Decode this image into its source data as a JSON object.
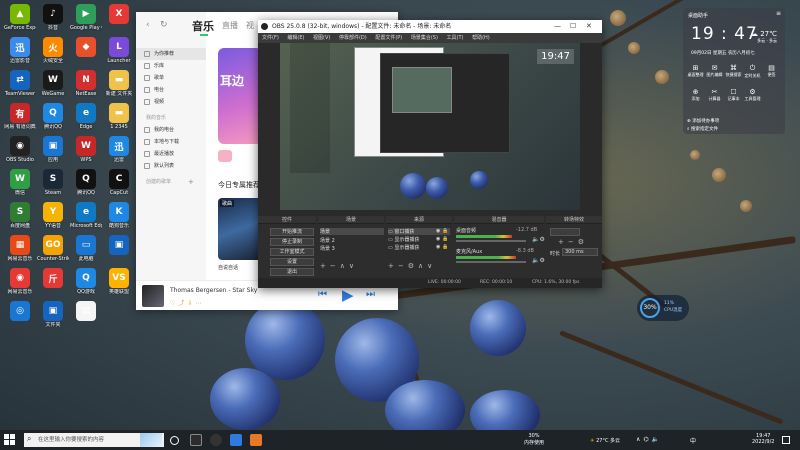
{
  "desktop": {
    "icons": [
      {
        "label": "GeForce Experience",
        "color": "#76b900",
        "glyph": "▲"
      },
      {
        "label": "抖音",
        "color": "#111111",
        "glyph": "♪"
      },
      {
        "label": "Google Play Games",
        "color": "#2f9e5b",
        "glyph": "▶"
      },
      {
        "label": "",
        "color": "#e53935",
        "glyph": "X"
      },
      {
        "label": "迅雷影音",
        "color": "#3b8be8",
        "glyph": "迅"
      },
      {
        "label": "火绒安全",
        "color": "#ff8a00",
        "glyph": "火"
      },
      {
        "label": "",
        "color": "#e94f2b",
        "glyph": "◆"
      },
      {
        "label": "Launcher",
        "color": "#7b4ad8",
        "glyph": "L"
      },
      {
        "label": "TeamViewer",
        "color": "#1565c0",
        "glyph": "⇄"
      },
      {
        "label": "WeGame",
        "color": "#1a1a1a",
        "glyph": "W"
      },
      {
        "label": "NetEase",
        "color": "#d32f2f",
        "glyph": "N"
      },
      {
        "label": "新建 文件夹",
        "color": "#f0c24b",
        "glyph": "▬"
      },
      {
        "label": "网易 有道词典",
        "color": "#c62828",
        "glyph": "有"
      },
      {
        "label": "腾讯QQ",
        "color": "#1e88e5",
        "glyph": "Q"
      },
      {
        "label": "Edge",
        "color": "#0f7ac3",
        "glyph": "e"
      },
      {
        "label": "1 2345",
        "color": "#f0c24b",
        "glyph": "▬"
      },
      {
        "label": "OBS Studio",
        "color": "#222222",
        "glyph": "◉"
      },
      {
        "label": "应用",
        "color": "#1976d2",
        "glyph": "▣"
      },
      {
        "label": "WPS",
        "color": "#c62828",
        "glyph": "W"
      },
      {
        "label": "迅雷",
        "color": "#1e88e5",
        "glyph": "迅"
      },
      {
        "label": "微信",
        "color": "#2ea043",
        "glyph": "W"
      },
      {
        "label": "Steam",
        "color": "#1b2838",
        "glyph": "S"
      },
      {
        "label": "腾讯QQ",
        "color": "#111111",
        "glyph": "Q"
      },
      {
        "label": "CapCut",
        "color": "#111111",
        "glyph": "C"
      },
      {
        "label": "百度网盘",
        "color": "#2e7d32",
        "glyph": "S"
      },
      {
        "label": "YY语音",
        "color": "#f4b400",
        "glyph": "Y"
      },
      {
        "label": "Microsoft Edge",
        "color": "#0f7ac3",
        "glyph": "e"
      },
      {
        "label": "酷狗音乐",
        "color": "#1e88e5",
        "glyph": "K"
      },
      {
        "label": "网易云音乐",
        "color": "#e64a19",
        "glyph": "▦"
      },
      {
        "label": "Counter-Strike Global Off...",
        "color": "#f4a300",
        "glyph": "GO"
      },
      {
        "label": "此电脑",
        "color": "#1976d2",
        "glyph": "▭"
      },
      {
        "label": "",
        "color": "#1565c0",
        "glyph": "▣"
      },
      {
        "label": "网易云音乐",
        "color": "#e53935",
        "glyph": "◉"
      },
      {
        "label": "",
        "color": "#e53935",
        "glyph": "斤"
      },
      {
        "label": "QQ游戏",
        "color": "#1e88e5",
        "glyph": "Q"
      },
      {
        "label": "英雄联盟",
        "color": "#ffb300",
        "glyph": "VS"
      },
      {
        "label": "",
        "color": "#1976d2",
        "glyph": "◎"
      },
      {
        "label": "文件夹",
        "color": "#1565c0",
        "glyph": "▣"
      },
      {
        "label": "",
        "color": "#f5f5f5",
        "glyph": "▤"
      }
    ]
  },
  "music_app": {
    "back": "‹",
    "refresh": "↻",
    "tabs": [
      "音乐",
      "直播",
      "视"
    ],
    "sidebar_items": [
      "为你推荐",
      "乐库",
      "歌单",
      "电台",
      "视频"
    ],
    "sidebar_heading_mine": "我的音乐",
    "sidebar_items_mine": [
      "我的电台",
      "本地与下载",
      "最近播放",
      "默认列表"
    ],
    "sidebar_heading_created": "创建的歌单",
    "banner_text": "耳边",
    "recommend_title": "今日专属推荐",
    "rec_badge": "歌曲",
    "rec_caption": "自说自话",
    "now_playing": "Thomas Bergersen - Star Sky",
    "player_prev": "⏮",
    "player_play": "▶",
    "player_next": "⏭"
  },
  "obs": {
    "title": "OBS 25.0.8 (32-bit, windows) - 配置文件: 未命名 - 场景: 未命名",
    "menu": [
      "文件(F)",
      "编辑(E)",
      "视图(V)",
      "停靠部件(D)",
      "配置文件(P)",
      "场景集合(S)",
      "工具(T)",
      "帮助(H)"
    ],
    "docks": {
      "controls": "控件",
      "scenes": "场景",
      "sources": "来源",
      "mixer": "混音器",
      "transitions": "转场特效"
    },
    "control_buttons": [
      "开始推流",
      "停止录制",
      "工作室模式",
      "设置",
      "退出"
    ],
    "scenes": [
      "场景",
      "场景 2",
      "场景 3"
    ],
    "sources": [
      "窗口捕获",
      "显示器捕获",
      "显示器捕获"
    ],
    "mixer_channels": [
      {
        "name": "桌面音频",
        "db": "-12.7 dB",
        "level": 0.78
      },
      {
        "name": "麦克风/Aux",
        "db": "-8.3 dB",
        "level": 0.84
      }
    ],
    "transition": {
      "duration_label": "时长",
      "duration_value": "300 ms"
    },
    "status": {
      "live": "LIVE: 00:00:00",
      "rec": "REC: 00:00:10",
      "cpu": "CPU: 1.6%, 30.00 fps"
    },
    "preview_clock": "19:47"
  },
  "widget": {
    "title": "桌面助手",
    "time": "19 : 47",
    "date": "09月02日  星期五  农历八月初七",
    "weather_temp": "27℃",
    "weather_desc": "多云 · 多云",
    "grid": [
      {
        "icon": "⊞",
        "label": "桌面整理"
      },
      {
        "icon": "✉",
        "label": "图片编辑"
      },
      {
        "icon": "⌘",
        "label": "快捷搜索"
      },
      {
        "icon": "⏻",
        "label": "定时关机"
      },
      {
        "icon": "▤",
        "label": "便签"
      },
      {
        "icon": "⊕",
        "label": "添加"
      },
      {
        "icon": "✂",
        "label": "计算器"
      },
      {
        "icon": "☐",
        "label": "记事本"
      },
      {
        "icon": "⚙",
        "label": "工具管理"
      },
      {
        "icon": "",
        "label": ""
      }
    ],
    "note_add": "添加待办事项",
    "note_search": "搜索指定文件"
  },
  "perf": {
    "percent": "30%",
    "line1": "11%",
    "line2": "CPU温度"
  },
  "taskbar": {
    "search_placeholder": "在这里输入你要搜索的内容",
    "memory_percent": "30%",
    "memory_label": "内存使用",
    "weather": "27°C 多云",
    "lang": "中",
    "clock_time": "19:47",
    "clock_date": "2022/9/2"
  }
}
